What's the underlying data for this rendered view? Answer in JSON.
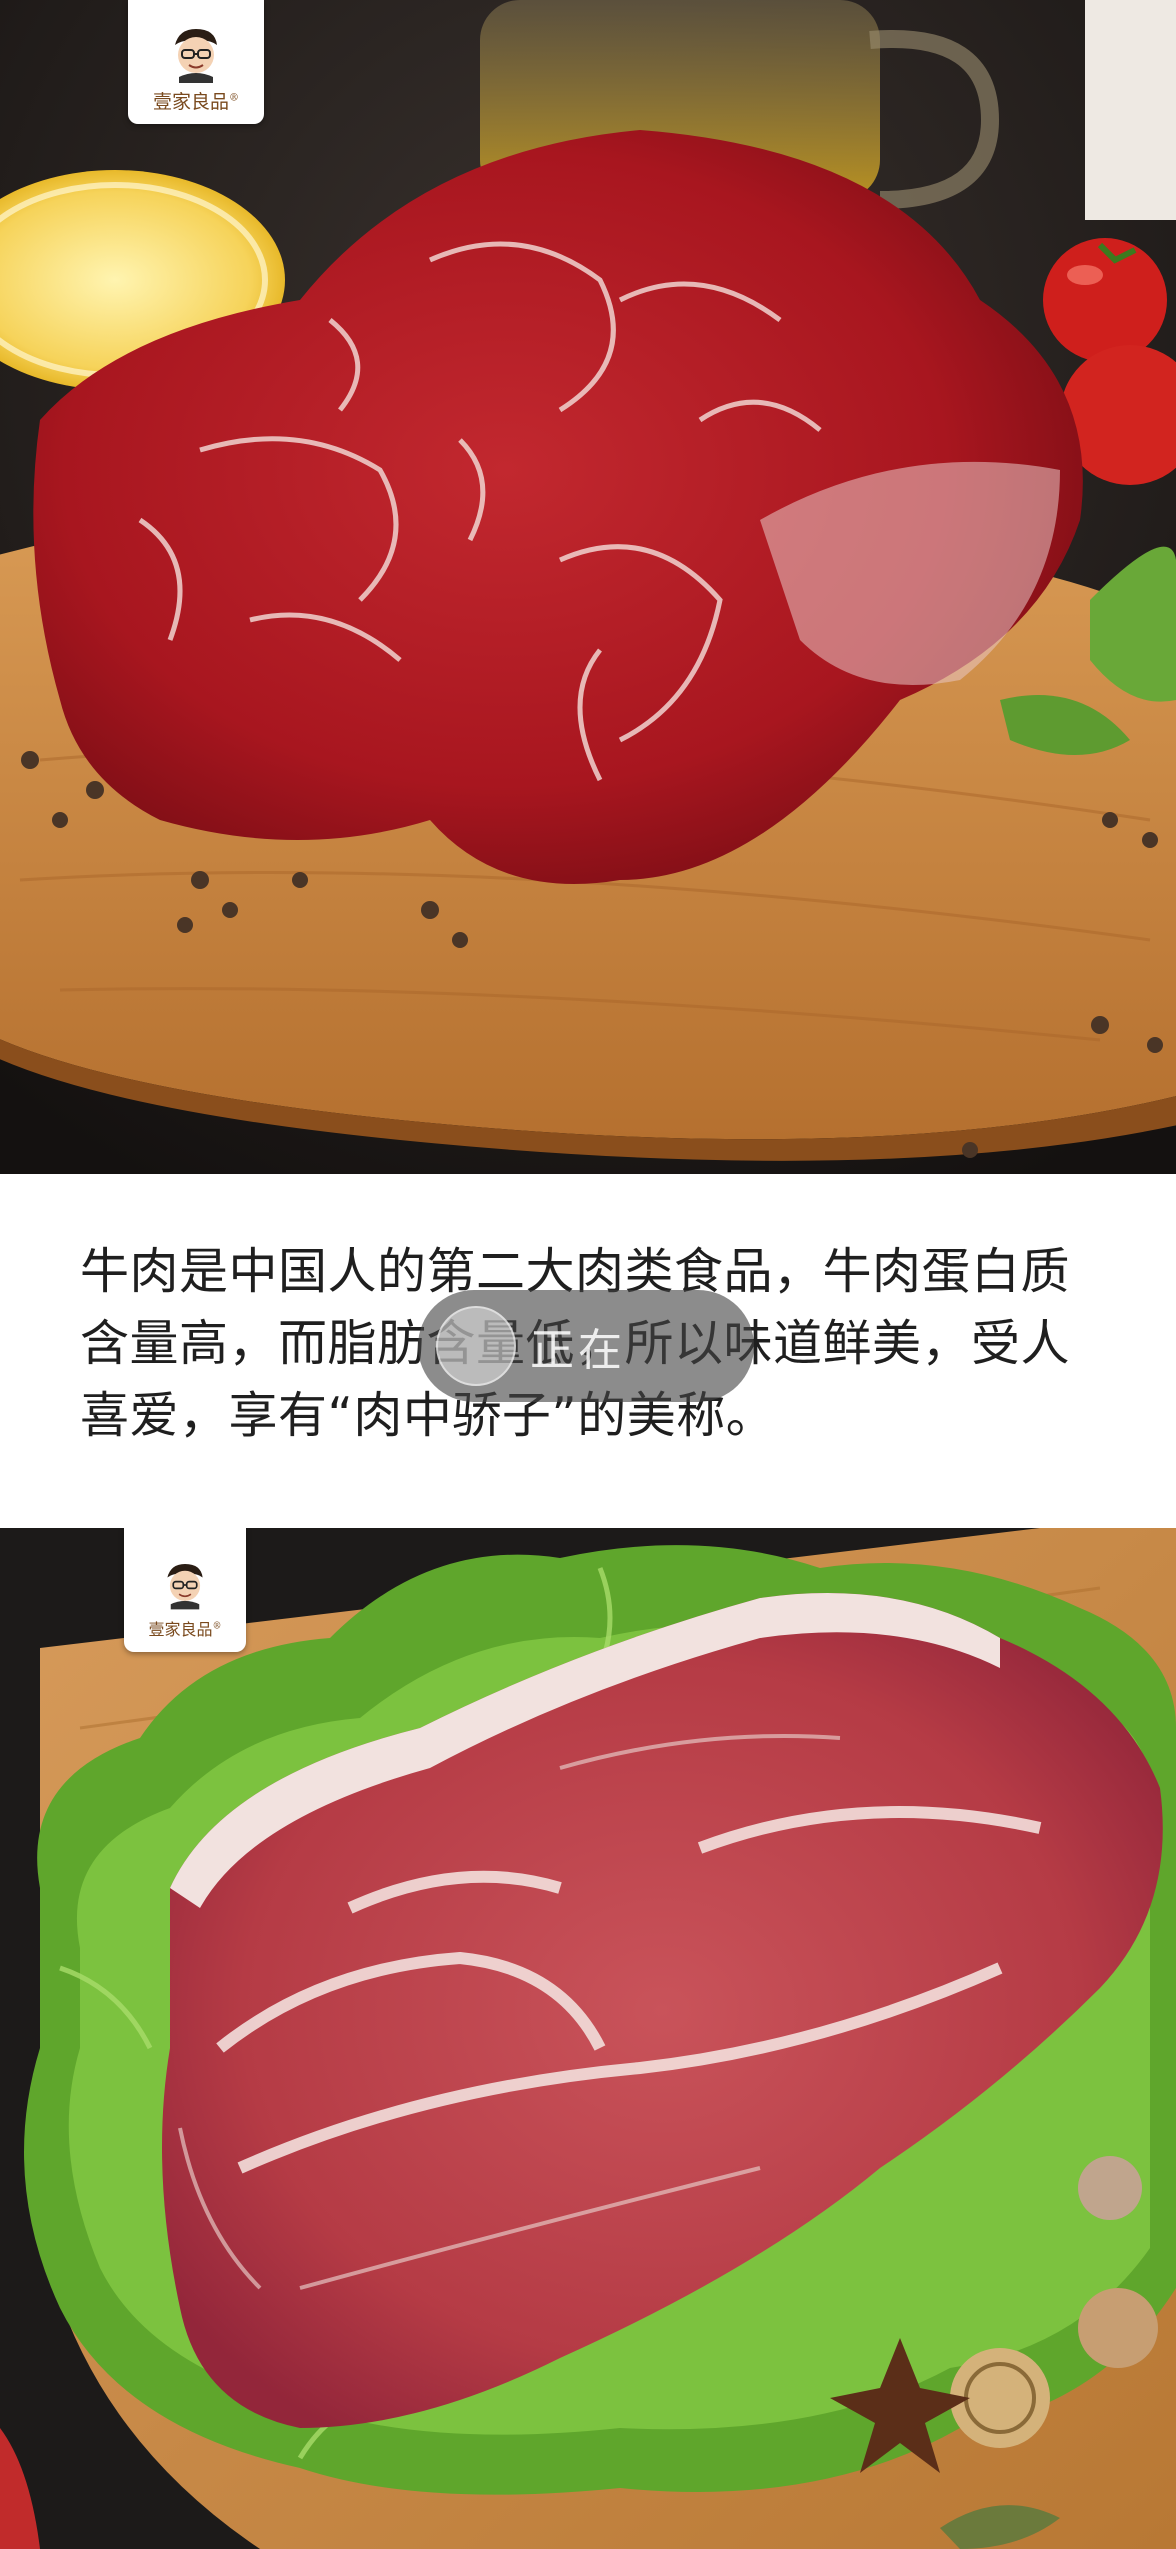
{
  "article": {
    "paragraph": "牛肉是中国人的第二大肉类食品，牛肉蛋白质含量高，而脂肪含量低，所以味道鲜美，受人喜爱，享有“肉中骄子”的美称。"
  },
  "images": [
    {
      "brand": {
        "name": "壹家良品",
        "mark": "®"
      }
    },
    {
      "brand": {
        "name": "壹家良品",
        "mark": "®"
      }
    }
  ],
  "overlay": {
    "label": "正在"
  },
  "colors": {
    "meat": "#b3202a",
    "board": "#c98a45",
    "lettuce": "#5fa62c",
    "background_dark": "#1e1a18",
    "brand_text": "#7a4a1e"
  }
}
